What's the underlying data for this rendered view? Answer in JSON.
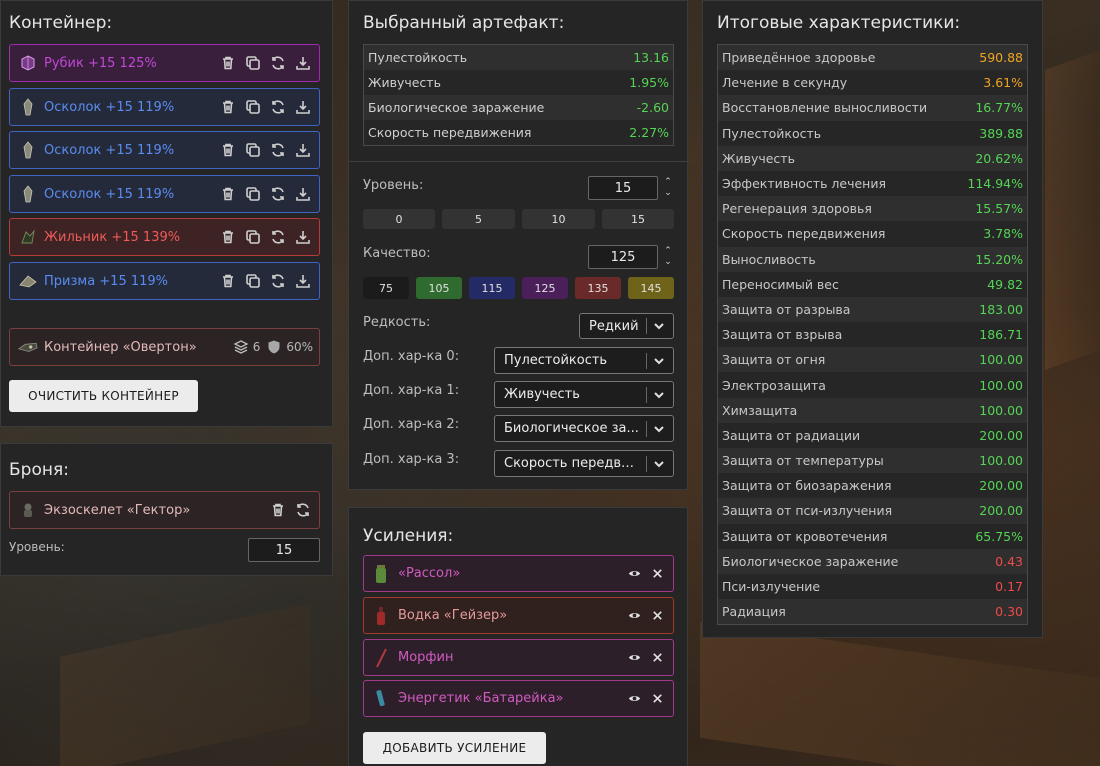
{
  "container": {
    "title": "Контейнер:",
    "slots": [
      {
        "label": "Рубик +15 125%",
        "icon": "cube-artifact-icon"
      },
      {
        "label": "Осколок +15 119%",
        "icon": "shard-artifact-icon"
      },
      {
        "label": "Осколок +15 119%",
        "icon": "shard-artifact-icon"
      },
      {
        "label": "Осколок +15 119%",
        "icon": "shard-artifact-icon"
      },
      {
        "label": "Жильник +15 139%",
        "icon": "vein-artifact-icon"
      },
      {
        "label": "Призма +15 119%",
        "icon": "prism-artifact-icon"
      }
    ],
    "item": {
      "label": "Контейнер «Овертон»",
      "slots_count": "6",
      "protection": "60%"
    },
    "clear_button": "ОЧИСТИТЬ КОНТЕЙНЕР"
  },
  "armor": {
    "title": "Броня:",
    "item_label": "Экзоскелет «Гектор»",
    "level_label": "Уровень:",
    "level_value": "15"
  },
  "artifact": {
    "title": "Выбранный артефакт:",
    "stats": [
      {
        "name": "Пулестойкость",
        "value": "13.16"
      },
      {
        "name": "Живучесть",
        "value": "1.95%"
      },
      {
        "name": "Биологическое заражение",
        "value": "-2.60"
      },
      {
        "name": "Скорость передвижения",
        "value": "2.27%"
      }
    ],
    "level_label": "Уровень:",
    "level_value": "15",
    "level_presets": [
      "0",
      "5",
      "10",
      "15"
    ],
    "quality_label": "Качество:",
    "quality_value": "125",
    "quality_presets": [
      {
        "label": "75",
        "color": "#1b1b1b"
      },
      {
        "label": "105",
        "color": "#2f6b2f"
      },
      {
        "label": "115",
        "color": "#232a66"
      },
      {
        "label": "125",
        "color": "#4a1f5a"
      },
      {
        "label": "135",
        "color": "#6a2a2a"
      },
      {
        "label": "145",
        "color": "#6e6318"
      }
    ],
    "rarity_label": "Редкость:",
    "rarity_value": "Редкий",
    "extra": [
      {
        "label": "Доп. хар-ка 0:",
        "value": "Пулестойкость"
      },
      {
        "label": "Доп. хар-ка 1:",
        "value": "Живучесть"
      },
      {
        "label": "Доп. хар-ка 2:",
        "value": "Биологическое за..."
      },
      {
        "label": "Доп. хар-ка 3:",
        "value": "Скорость передви..."
      }
    ]
  },
  "boosts": {
    "title": "Усиления:",
    "items": [
      {
        "label": "«Рассол»",
        "icon": "jar-icon"
      },
      {
        "label": "Водка «Гейзер»",
        "icon": "bottle-icon"
      },
      {
        "label": "Морфин",
        "icon": "syringe-icon"
      },
      {
        "label": "Энергетик «Батарейка»",
        "icon": "energy-drink-icon"
      }
    ],
    "add_button": "ДОБАВИТЬ УСИЛЕНИЕ"
  },
  "totals": {
    "title": "Итоговые характеристики:",
    "stats": [
      {
        "name": "Приведённое здоровье",
        "value": "590.88",
        "tone": "orange"
      },
      {
        "name": "Лечение в секунду",
        "value": "3.61%",
        "tone": "orange"
      },
      {
        "name": "Восстановление выносливости",
        "value": "16.77%",
        "tone": "green"
      },
      {
        "name": "Пулестойкость",
        "value": "389.88",
        "tone": "green"
      },
      {
        "name": "Живучесть",
        "value": "20.62%",
        "tone": "green"
      },
      {
        "name": "Эффективность лечения",
        "value": "114.94%",
        "tone": "green"
      },
      {
        "name": "Регенерация здоровья",
        "value": "15.57%",
        "tone": "green"
      },
      {
        "name": "Скорость передвижения",
        "value": "3.78%",
        "tone": "green"
      },
      {
        "name": "Выносливость",
        "value": "15.20%",
        "tone": "green"
      },
      {
        "name": "Переносимый вес",
        "value": "49.82",
        "tone": "green"
      },
      {
        "name": "Защита от разрыва",
        "value": "183.00",
        "tone": "green"
      },
      {
        "name": "Защита от взрыва",
        "value": "186.71",
        "tone": "green"
      },
      {
        "name": "Защита от огня",
        "value": "100.00",
        "tone": "green"
      },
      {
        "name": "Электрозащита",
        "value": "100.00",
        "tone": "green"
      },
      {
        "name": "Химзащита",
        "value": "100.00",
        "tone": "green"
      },
      {
        "name": "Защита от радиации",
        "value": "200.00",
        "tone": "green"
      },
      {
        "name": "Защита от температуры",
        "value": "100.00",
        "tone": "green"
      },
      {
        "name": "Защита от биозаражения",
        "value": "200.00",
        "tone": "green"
      },
      {
        "name": "Защита от пси-излучения",
        "value": "200.00",
        "tone": "green"
      },
      {
        "name": "Защита от кровотечения",
        "value": "65.75%",
        "tone": "green"
      },
      {
        "name": "Биологическое заражение",
        "value": "0.43",
        "tone": "red"
      },
      {
        "name": "Пси-излучение",
        "value": "0.17",
        "tone": "red"
      },
      {
        "name": "Радиация",
        "value": "0.30",
        "tone": "red"
      }
    ]
  }
}
